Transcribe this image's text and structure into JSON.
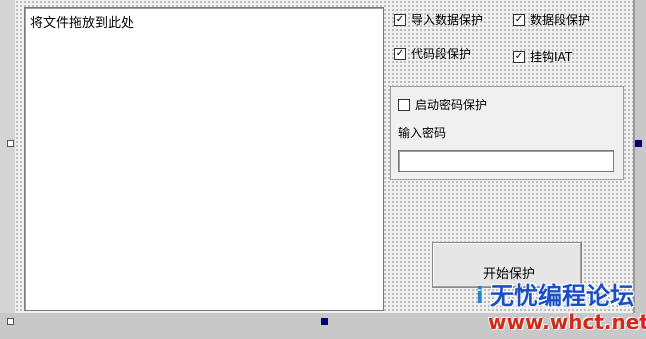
{
  "drop_area": {
    "label": "将文件拖放到此处"
  },
  "options": [
    {
      "id": "import-protect",
      "label": "导入数据保护",
      "checked": true
    },
    {
      "id": "data-protect",
      "label": "数据段保护",
      "checked": true
    },
    {
      "id": "code-protect",
      "label": "代码段保护",
      "checked": true
    },
    {
      "id": "hook-iat",
      "label": "挂钩IAT",
      "checked": true
    }
  ],
  "password": {
    "enable_label": "启动密码保护",
    "enable_checked": false,
    "input_label": "输入密码",
    "value": ""
  },
  "start_button": {
    "label": "开始保护"
  },
  "watermark": {
    "title": "无忧编程论坛",
    "url": "www.whct.net"
  },
  "check_mark": "✓"
}
